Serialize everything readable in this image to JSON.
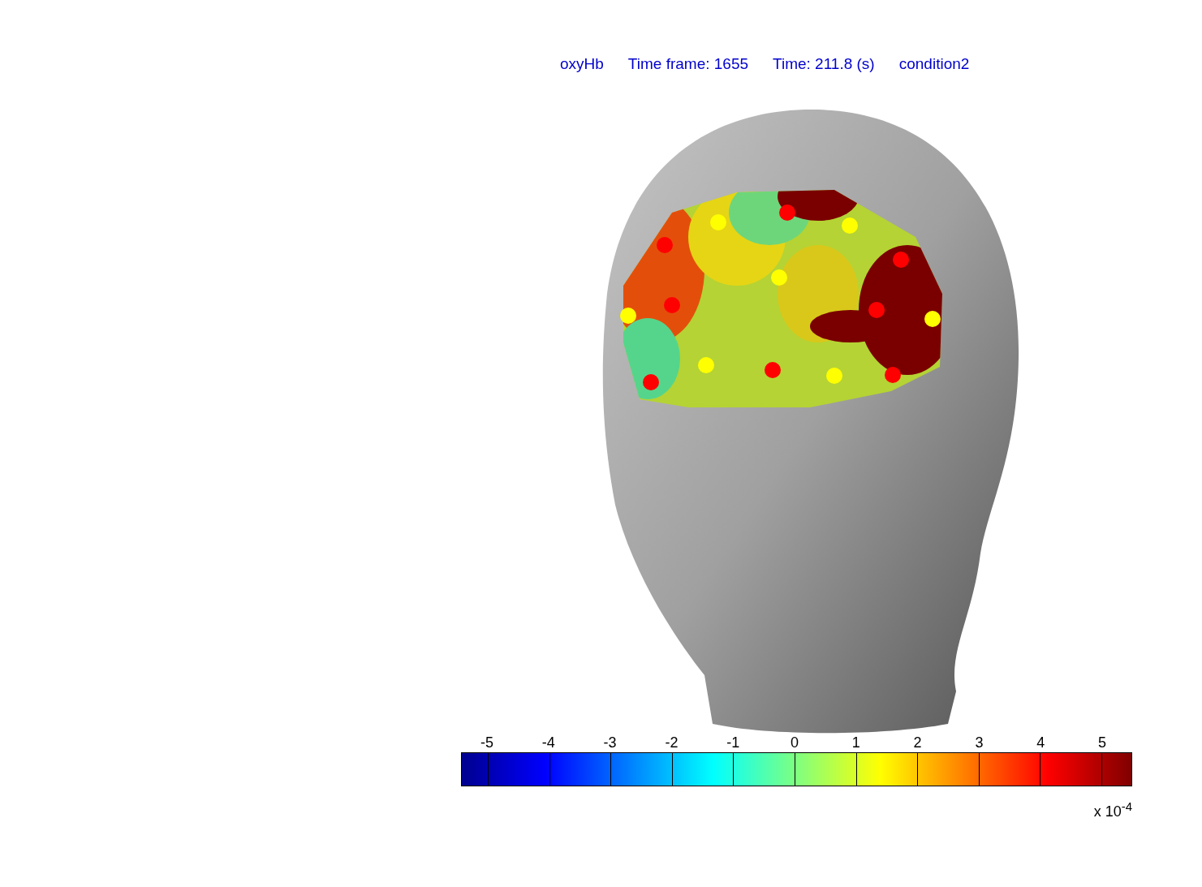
{
  "title": [
    "oxyHb",
    "Time frame: 1655",
    "Time: 211.8 (s)",
    "condition2"
  ],
  "colorbar": {
    "ticks": [
      "-5",
      "-4",
      "-3",
      "-2",
      "-1",
      "0",
      "1",
      "2",
      "3",
      "4",
      "5"
    ],
    "exponent": "x 10$^{-4}$"
  }
}
